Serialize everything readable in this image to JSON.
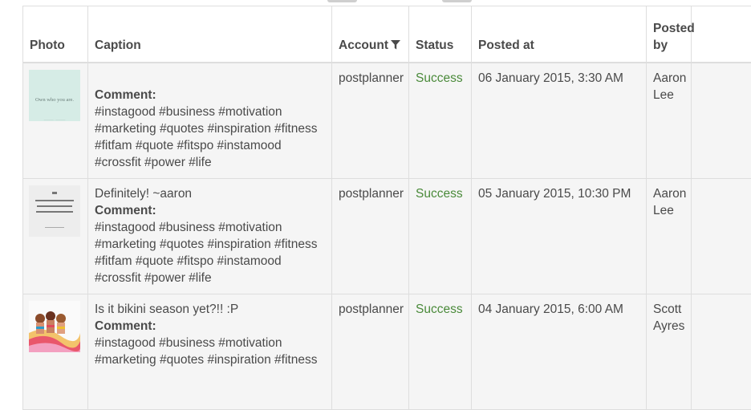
{
  "columns": {
    "photo": "Photo",
    "caption": "Caption",
    "account": "Account",
    "status": "Status",
    "posted_at": "Posted at",
    "posted_by": "Posted by"
  },
  "rows": [
    {
      "photo_text": "Own who you are.",
      "caption": "",
      "comment_label": "Comment:",
      "comment_lines": [
        "#instagood #business #motivation",
        "#marketing #quotes #inspiration #fitness",
        "#fitfam #quote #fitspo #instamood",
        "#crossfit #power #life"
      ],
      "account": "postplanner",
      "status": "Success",
      "posted_at": "06 January 2015, 3:30 AM",
      "posted_by_line1": "Aaron",
      "posted_by_line2": "Lee"
    },
    {
      "caption": "Definitely! ~aaron",
      "comment_label": "Comment:",
      "comment_lines": [
        "#instagood #business #motivation",
        "#marketing #quotes #inspiration #fitness",
        "#fitfam #quote #fitspo #instamood",
        "#crossfit #power #life"
      ],
      "account": "postplanner",
      "status": "Success",
      "posted_at": "05 January 2015, 10:30 PM",
      "posted_by_line1": "Aaron",
      "posted_by_line2": "Lee"
    },
    {
      "caption": "Is it bikini season yet?!! :P",
      "comment_label": "Comment:",
      "comment_lines": [
        "#instagood #business #motivation",
        "#marketing #quotes #inspiration #fitness"
      ],
      "account": "postplanner",
      "status": "Success",
      "posted_at": "04 January 2015, 6:00 AM",
      "posted_by_line1": "Scott",
      "posted_by_line2": "Ayres"
    }
  ],
  "colors": {
    "status_success": "#4a8a3a",
    "row_bg": "#f5f5f5",
    "border": "#dedede"
  },
  "icons": {
    "account_filter": "filter-icon"
  }
}
